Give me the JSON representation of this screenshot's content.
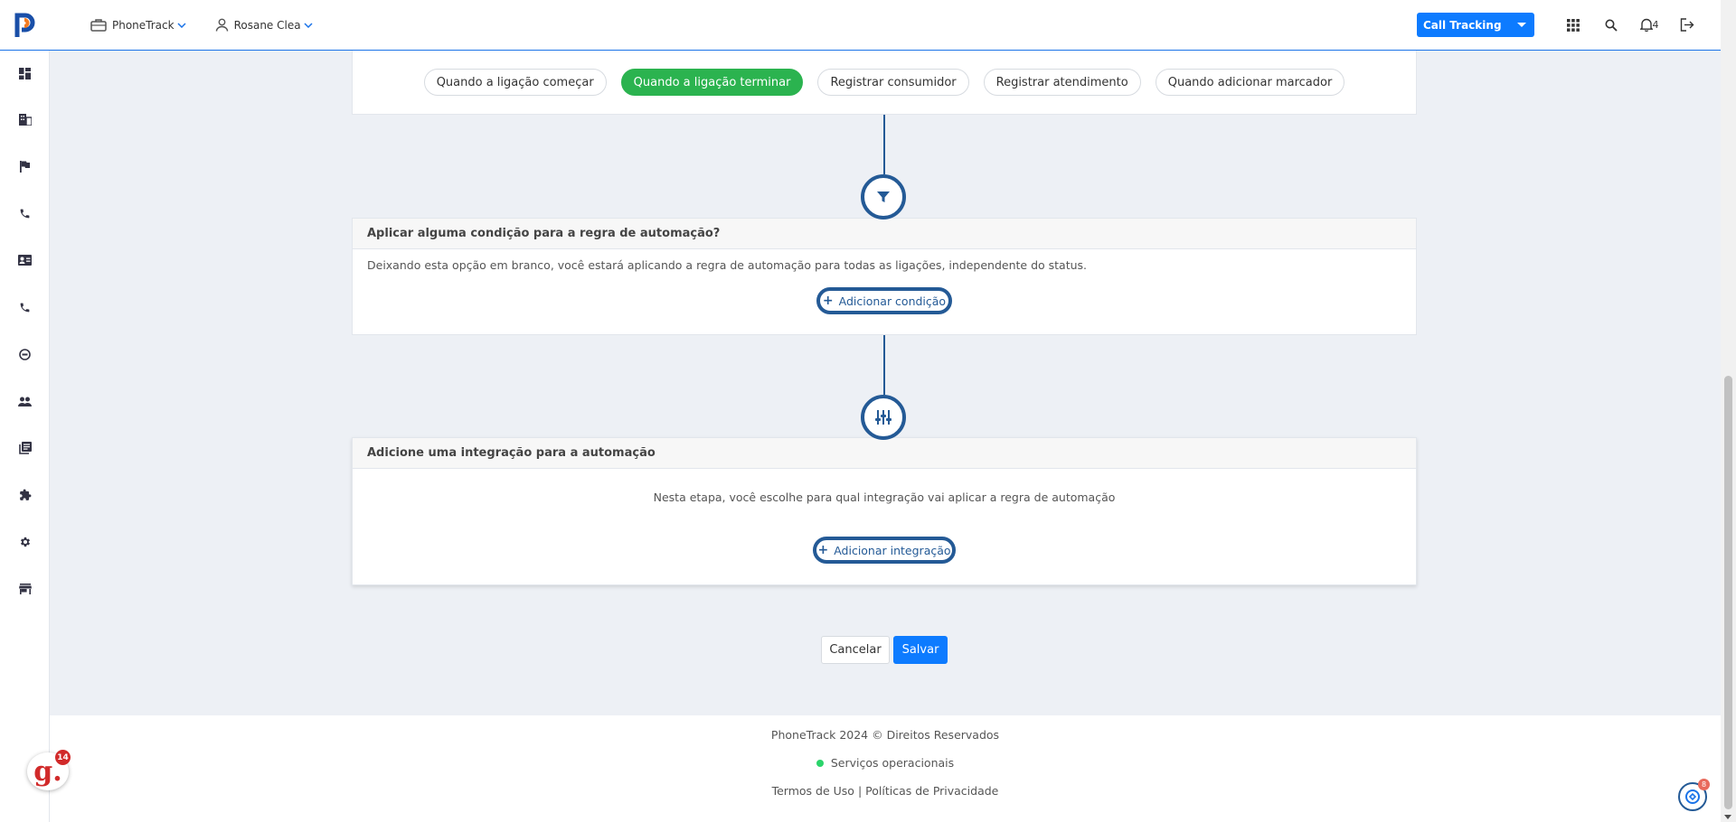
{
  "topbar": {
    "company": "PhoneTrack",
    "user": "Rosane Clea",
    "product": "Call Tracking",
    "notifications_count": "4"
  },
  "sidebar": {
    "items": [
      "dashboard-icon",
      "building-icon",
      "flag-icon",
      "phone-icon",
      "contact-card-icon",
      "phone-icon",
      "target-icon",
      "people-icon",
      "library-icon",
      "puzzle-icon",
      "gear-icon",
      "store-icon"
    ]
  },
  "triggers": {
    "items": [
      "Quando a ligação começar",
      "Quando a ligação terminar",
      "Registrar consumidor",
      "Registrar atendimento",
      "Quando adicionar marcador"
    ],
    "active": "Quando a ligação terminar"
  },
  "condition": {
    "title": "Aplicar alguma condição para a regra de automação?",
    "description": "Deixando esta opção em branco, você estará aplicando a regra de automação para todas as ligações, independente do status.",
    "button": "Adicionar condição"
  },
  "integration": {
    "title": "Adicione uma integração para a automação",
    "description": "Nesta etapa, você escolhe para qual integração vai aplicar a regra de automação",
    "button": "Adicionar integração"
  },
  "actions": {
    "cancel": "Cancelar",
    "save": "Salvar"
  },
  "footer": {
    "copyright": "PhoneTrack 2024 © Direitos Reservados",
    "status": "Serviços operacionais",
    "terms": "Termos de Uso",
    "separator": "|",
    "privacy": "Políticas de Privacidade"
  },
  "widgets": {
    "g_letter": "g.",
    "g_count": "14",
    "chat_count": "8"
  },
  "colors": {
    "primary": "#0d7bff",
    "active_trigger": "#2bb34f",
    "flow_line": "#245a96",
    "status_ok": "#2bd46b"
  }
}
